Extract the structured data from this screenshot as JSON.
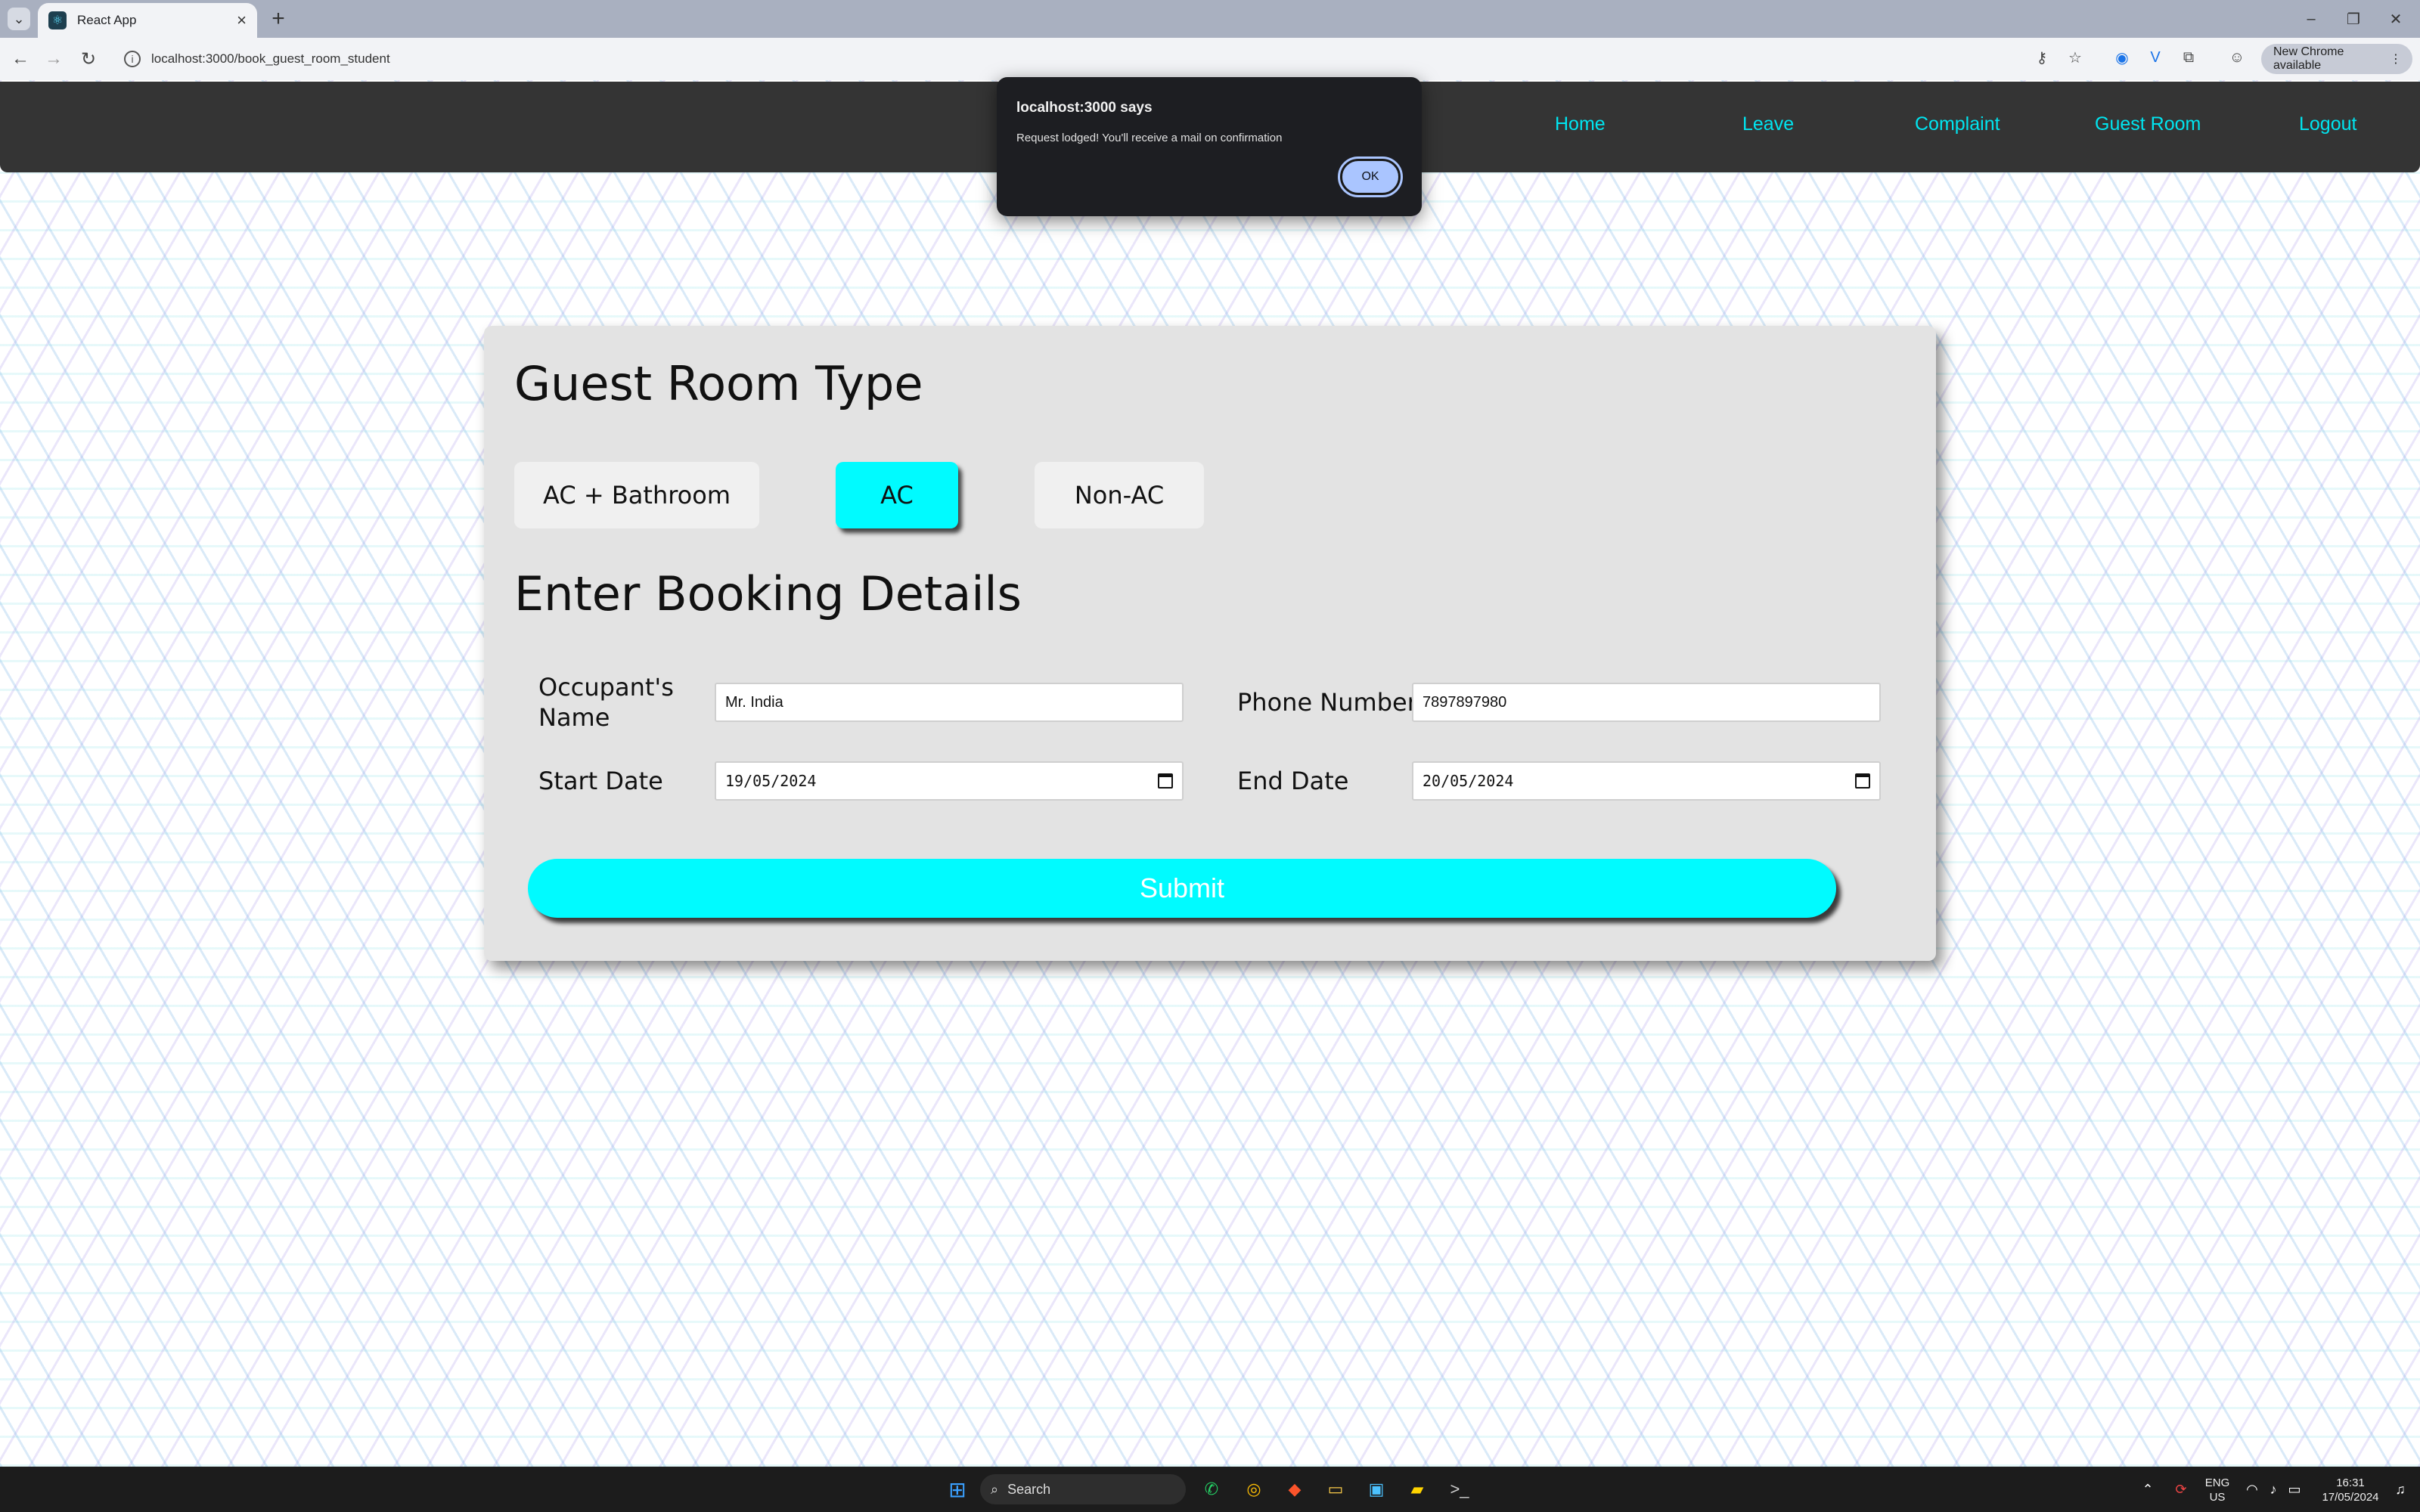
{
  "browser": {
    "tab_title": "React App",
    "url": "localhost:3000/book_guest_room_student",
    "update_label": "New Chrome available"
  },
  "navbar": {
    "links": [
      "Home",
      "Leave",
      "Complaint",
      "Guest Room",
      "Logout"
    ]
  },
  "booking": {
    "room_type_heading": "Guest Room Type",
    "room_types": [
      "AC + Bathroom",
      "AC",
      "Non-AC"
    ],
    "selected_room_type": "AC",
    "details_heading": "Enter Booking Details",
    "occupant_label": "Occupant's Name",
    "occupant_value": "Mr. India",
    "phone_label": "Phone Number",
    "phone_value": "7897897980",
    "start_label": "Start Date",
    "start_value": "19/05/2024",
    "end_label": "End Date",
    "end_value": "20/05/2024",
    "submit_label": "Submit"
  },
  "dialog": {
    "title": "localhost:3000 says",
    "message": "Request lodged! You'll receive a mail on confirmation",
    "ok_label": "OK"
  },
  "taskbar": {
    "search_label": "Search",
    "lang_line1": "ENG",
    "lang_line2": "US",
    "time": "16:31",
    "date": "17/05/2024"
  },
  "colors": {
    "accent": "#00fbff",
    "nav_link": "#00e5f0",
    "navbar_bg": "#343434",
    "card_bg": "#e3e3e3"
  }
}
